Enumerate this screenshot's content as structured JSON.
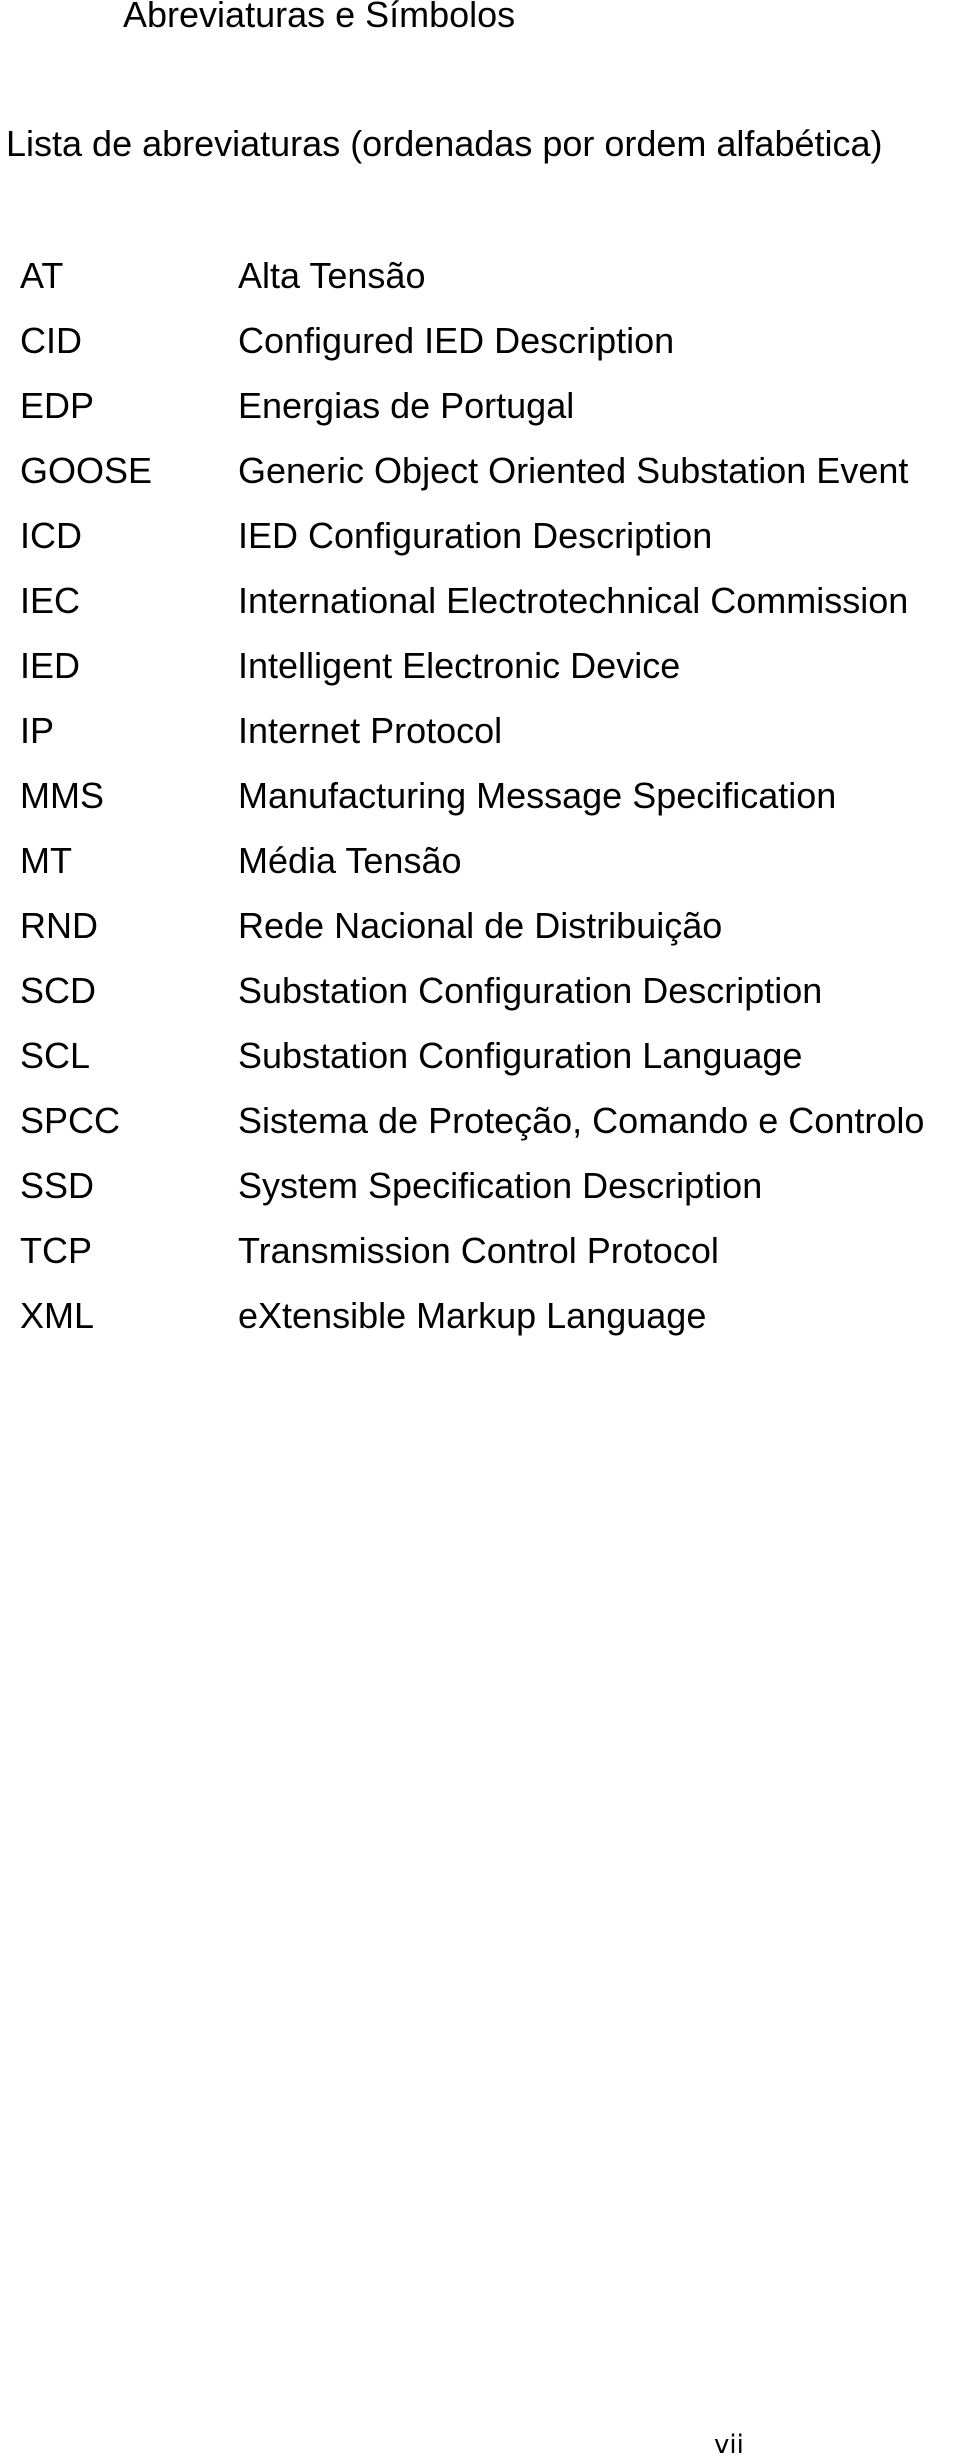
{
  "page": {
    "title": "Abreviaturas e Símbolos",
    "list_heading": "Lista de abreviaturas (ordenadas por ordem alfabética)",
    "page_number": "vii"
  },
  "abbreviations": [
    {
      "abbr": "AT",
      "definition": "Alta Tensão"
    },
    {
      "abbr": "CID",
      "definition": "Configured IED Description"
    },
    {
      "abbr": "EDP",
      "definition": "Energias de Portugal"
    },
    {
      "abbr": "GOOSE",
      "definition": "Generic Object Oriented Substation Event"
    },
    {
      "abbr": "ICD",
      "definition": "IED Configuration Description"
    },
    {
      "abbr": "IEC",
      "definition": "International Electrotechnical Commission"
    },
    {
      "abbr": "IED",
      "definition": "Intelligent Electronic Device"
    },
    {
      "abbr": "IP",
      "definition": "Internet Protocol"
    },
    {
      "abbr": "MMS",
      "definition": "Manufacturing Message Specification"
    },
    {
      "abbr": "MT",
      "definition": "Média Tensão"
    },
    {
      "abbr": "RND",
      "definition": "Rede Nacional de Distribuição"
    },
    {
      "abbr": "SCD",
      "definition": "Substation Configuration Description"
    },
    {
      "abbr": "SCL",
      "definition": "Substation Configuration Language"
    },
    {
      "abbr": "SPCC",
      "definition": "Sistema de Proteção, Comando e Controlo"
    },
    {
      "abbr": "SSD",
      "definition": "System Specification Description"
    },
    {
      "abbr": "TCP",
      "definition": "Transmission Control Protocol"
    },
    {
      "abbr": "XML",
      "definition": "eXtensible Markup Language"
    }
  ]
}
